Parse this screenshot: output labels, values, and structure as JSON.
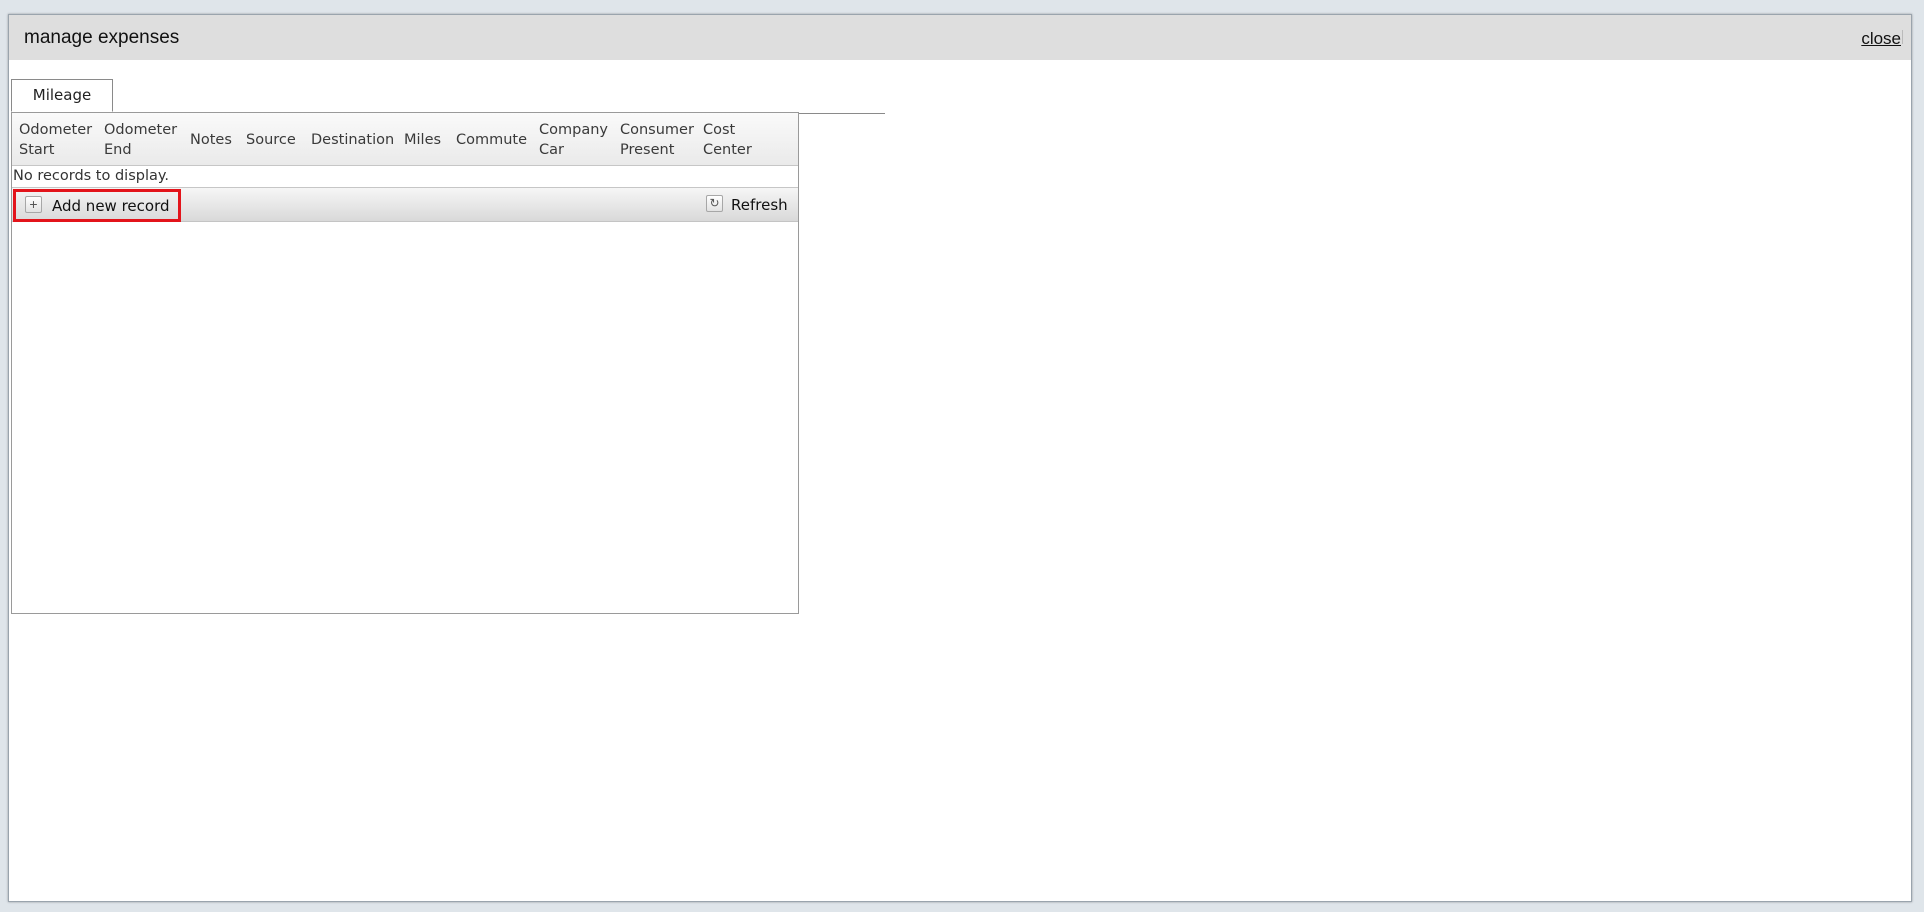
{
  "dialog": {
    "title": "manage expenses",
    "close_label": "close"
  },
  "tabs": [
    {
      "label": "Mileage",
      "selected": true
    }
  ],
  "grid": {
    "columns": [
      {
        "line1": "Odometer",
        "line2": "Start"
      },
      {
        "line1": "Odometer",
        "line2": "End"
      },
      {
        "line1": "Notes",
        "line2": ""
      },
      {
        "line1": "Source",
        "line2": ""
      },
      {
        "line1": "Destination",
        "line2": ""
      },
      {
        "line1": "Miles",
        "line2": ""
      },
      {
        "line1": "Commute",
        "line2": ""
      },
      {
        "line1": "Company",
        "line2": "Car"
      },
      {
        "line1": "Consumer",
        "line2": "Present"
      },
      {
        "line1": "Cost",
        "line2": "Center"
      }
    ],
    "empty_message": "No records to display.",
    "add_label": "Add new record",
    "refresh_label": "Refresh",
    "add_icon": "plus-icon",
    "refresh_icon": "refresh-icon"
  },
  "colors": {
    "highlight": "#e3141b",
    "titlebar": "#dedede"
  }
}
